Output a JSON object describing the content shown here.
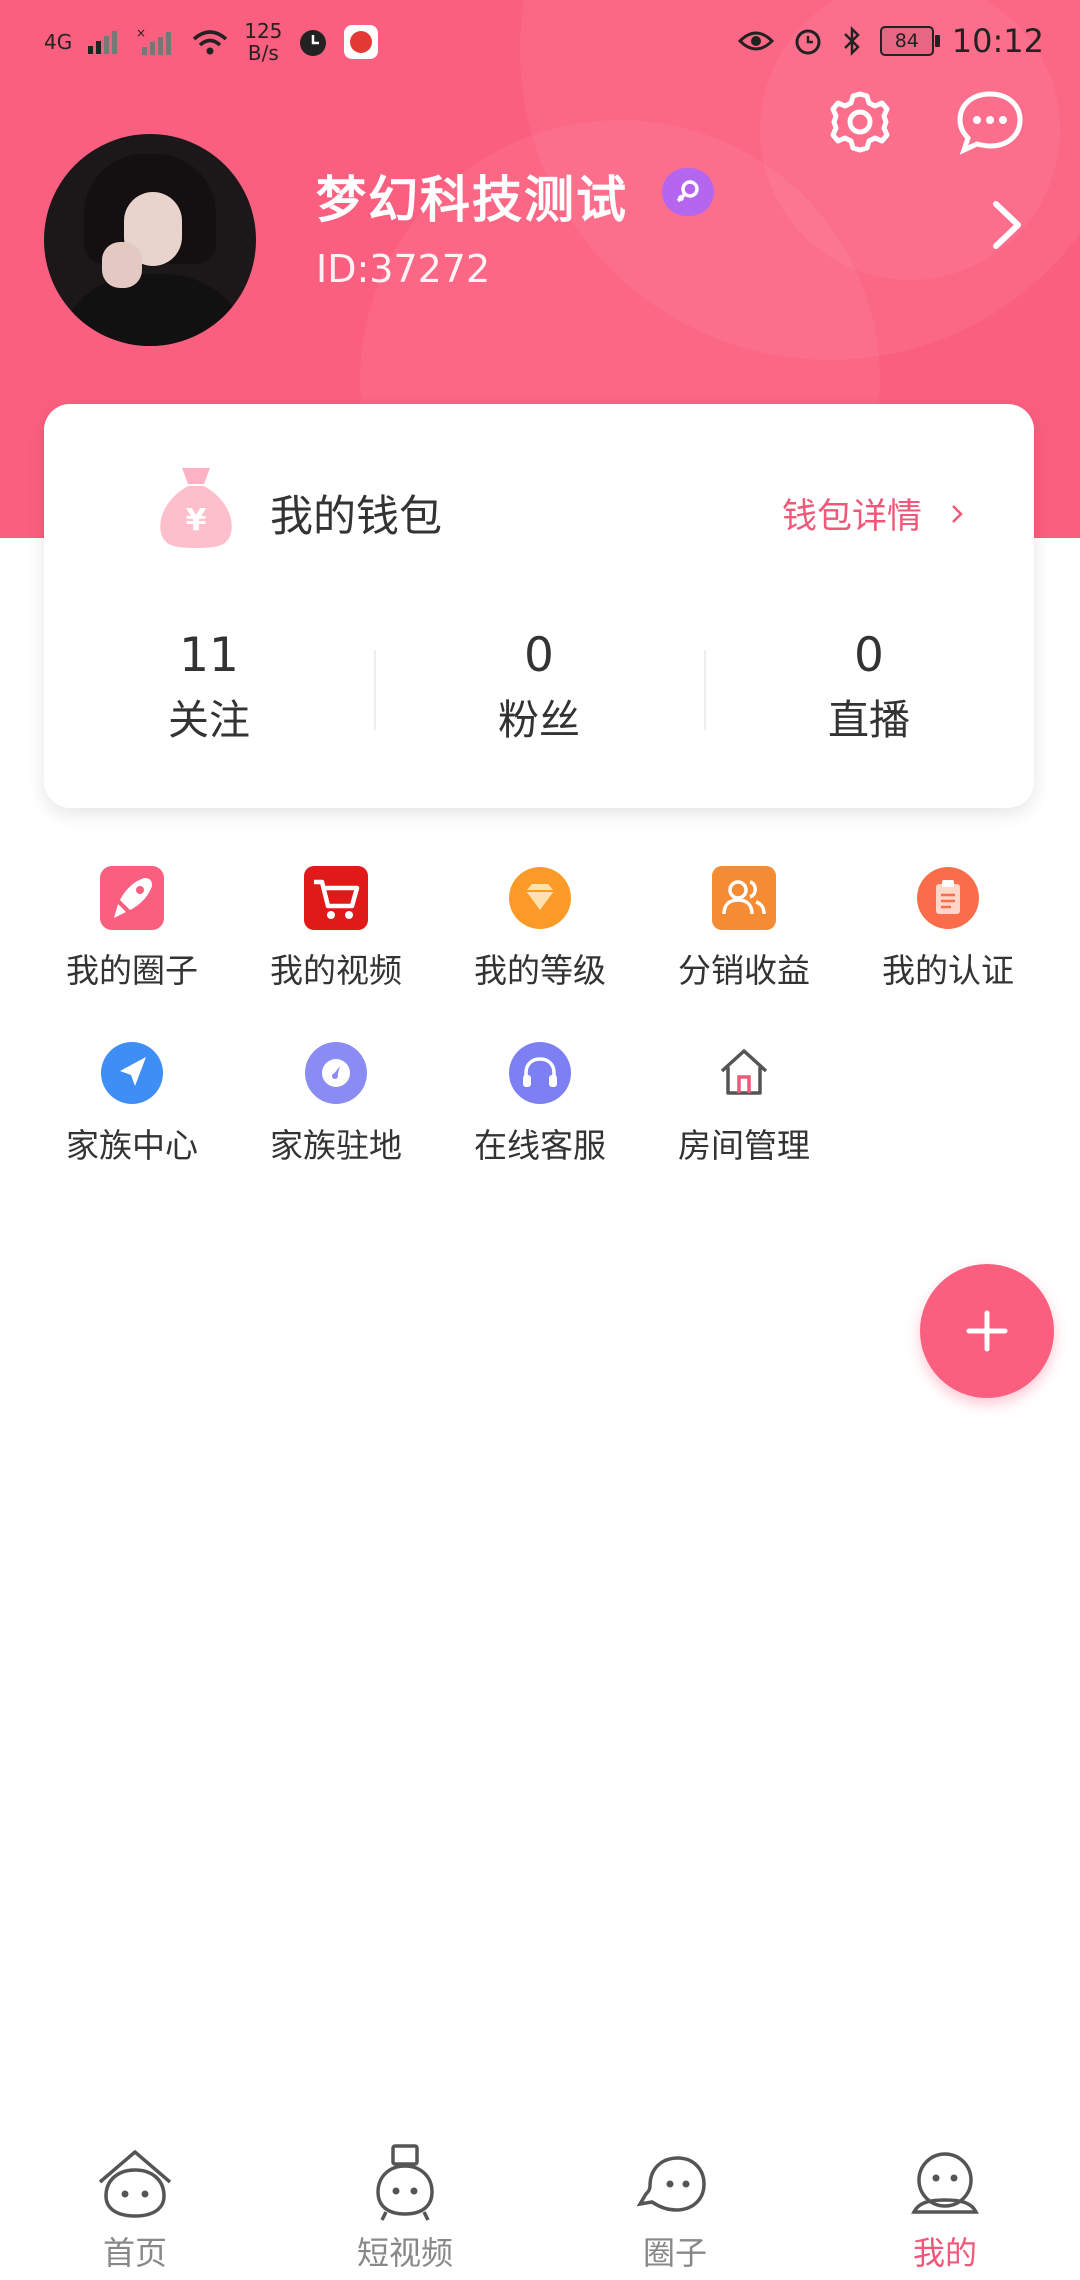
{
  "status_bar": {
    "network": "4G",
    "speed_value": "125",
    "speed_unit": "B/s",
    "battery": "84",
    "time": "10:12"
  },
  "profile": {
    "name": "梦幻科技测试",
    "id": "ID:37272"
  },
  "wallet": {
    "title": "我的钱包",
    "detail_link": "钱包详情",
    "stats": [
      {
        "value": "11",
        "label": "关注"
      },
      {
        "value": "0",
        "label": "粉丝"
      },
      {
        "value": "0",
        "label": "直播"
      }
    ]
  },
  "menu": {
    "row1": [
      {
        "label": "我的圈子",
        "icon": "rocket-icon"
      },
      {
        "label": "我的视频",
        "icon": "cart-icon"
      },
      {
        "label": "我的等级",
        "icon": "diamond-icon"
      },
      {
        "label": "分销收益",
        "icon": "users-icon"
      },
      {
        "label": "我的认证",
        "icon": "clipboard-icon"
      }
    ],
    "row2": [
      {
        "label": "家族中心",
        "icon": "navigation-icon"
      },
      {
        "label": "家族驻地",
        "icon": "compass-icon"
      },
      {
        "label": "在线客服",
        "icon": "headset-icon"
      },
      {
        "label": "房间管理",
        "icon": "home-icon"
      }
    ]
  },
  "bottom_nav": [
    {
      "label": "首页",
      "icon": "home-face-icon"
    },
    {
      "label": "短视频",
      "icon": "video-face-icon"
    },
    {
      "label": "圈子",
      "icon": "chat-face-icon"
    },
    {
      "label": "我的",
      "icon": "me-face-icon",
      "active": true
    }
  ],
  "colors": {
    "accent": "#fb5f7f",
    "link": "#f0587a",
    "gender_badge": "#b566ef"
  }
}
